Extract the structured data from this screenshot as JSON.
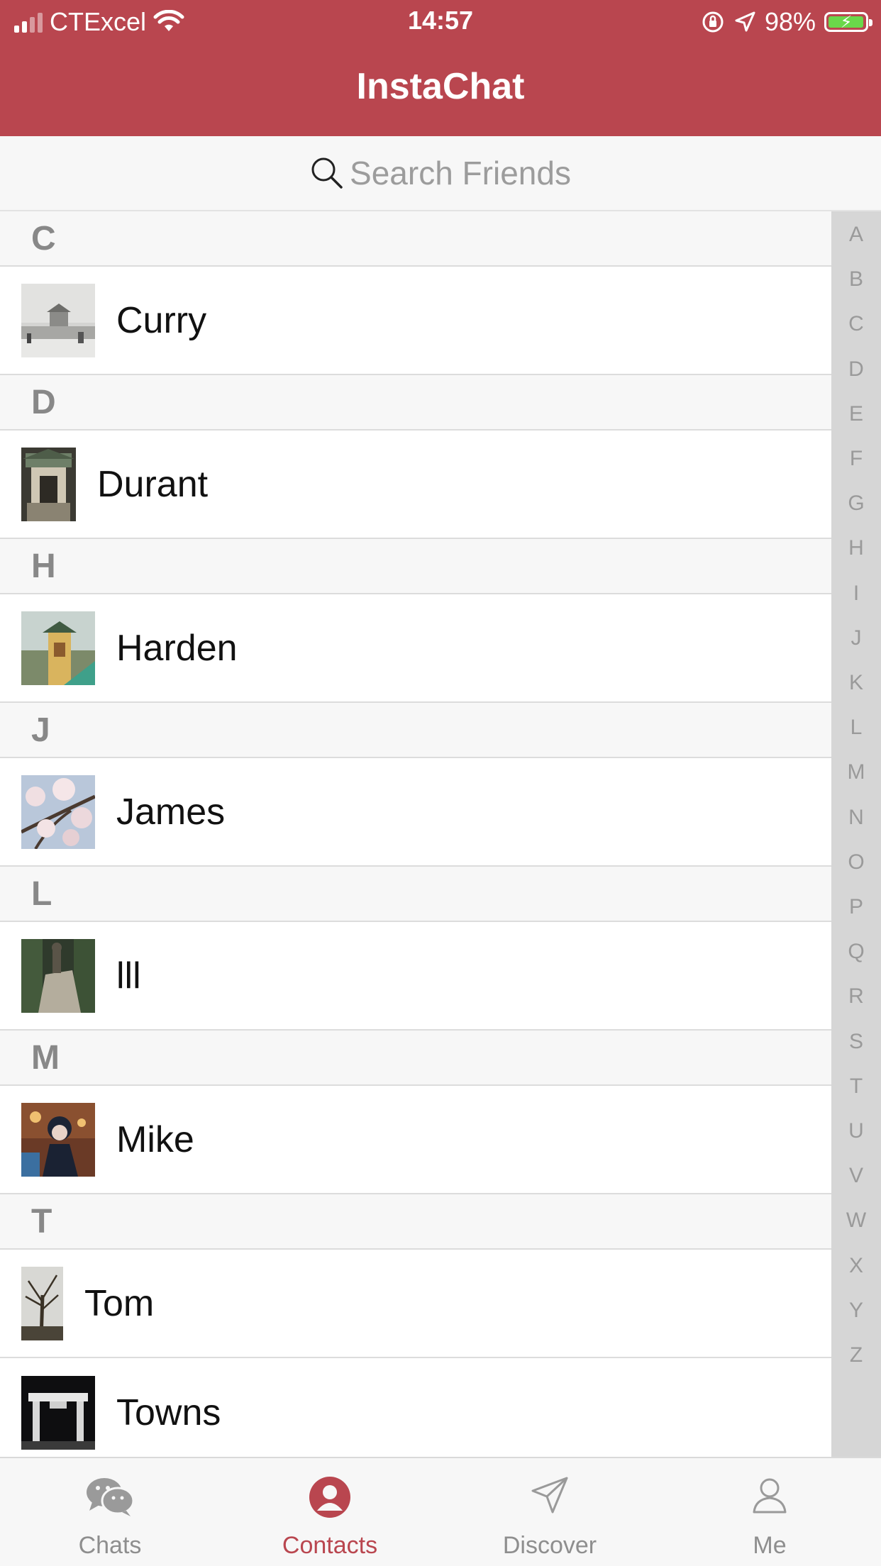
{
  "status_bar": {
    "carrier": "CTExcel",
    "time": "14:57",
    "battery": "98%",
    "battery_level": 0.98
  },
  "header": {
    "title": "InstaChat"
  },
  "search": {
    "placeholder": "Search Friends"
  },
  "sections": [
    {
      "letter": "C",
      "contacts": [
        {
          "name": "Curry"
        }
      ]
    },
    {
      "letter": "D",
      "contacts": [
        {
          "name": "Durant"
        }
      ]
    },
    {
      "letter": "H",
      "contacts": [
        {
          "name": "Harden"
        }
      ]
    },
    {
      "letter": "J",
      "contacts": [
        {
          "name": "James"
        }
      ]
    },
    {
      "letter": "L",
      "contacts": [
        {
          "name": "lll"
        }
      ]
    },
    {
      "letter": "M",
      "contacts": [
        {
          "name": "Mike"
        }
      ]
    },
    {
      "letter": "T",
      "contacts": [
        {
          "name": "Tom"
        },
        {
          "name": "Towns"
        }
      ]
    }
  ],
  "index_letters": [
    "A",
    "B",
    "C",
    "D",
    "E",
    "F",
    "G",
    "H",
    "I",
    "J",
    "K",
    "L",
    "M",
    "N",
    "O",
    "P",
    "Q",
    "R",
    "S",
    "T",
    "U",
    "V",
    "W",
    "X",
    "Y",
    "Z"
  ],
  "tabs": [
    {
      "label": "Chats",
      "icon": "chat-bubbles-icon"
    },
    {
      "label": "Contacts",
      "icon": "contacts-person-icon",
      "active": true
    },
    {
      "label": "Discover",
      "icon": "paper-plane-icon"
    },
    {
      "label": "Me",
      "icon": "user-outline-icon"
    }
  ],
  "colors": {
    "accent": "#b9464f",
    "section_bg": "#f7f7f7",
    "index_bar_bg": "#d6d6d6",
    "battery_green": "#6ad74a"
  }
}
